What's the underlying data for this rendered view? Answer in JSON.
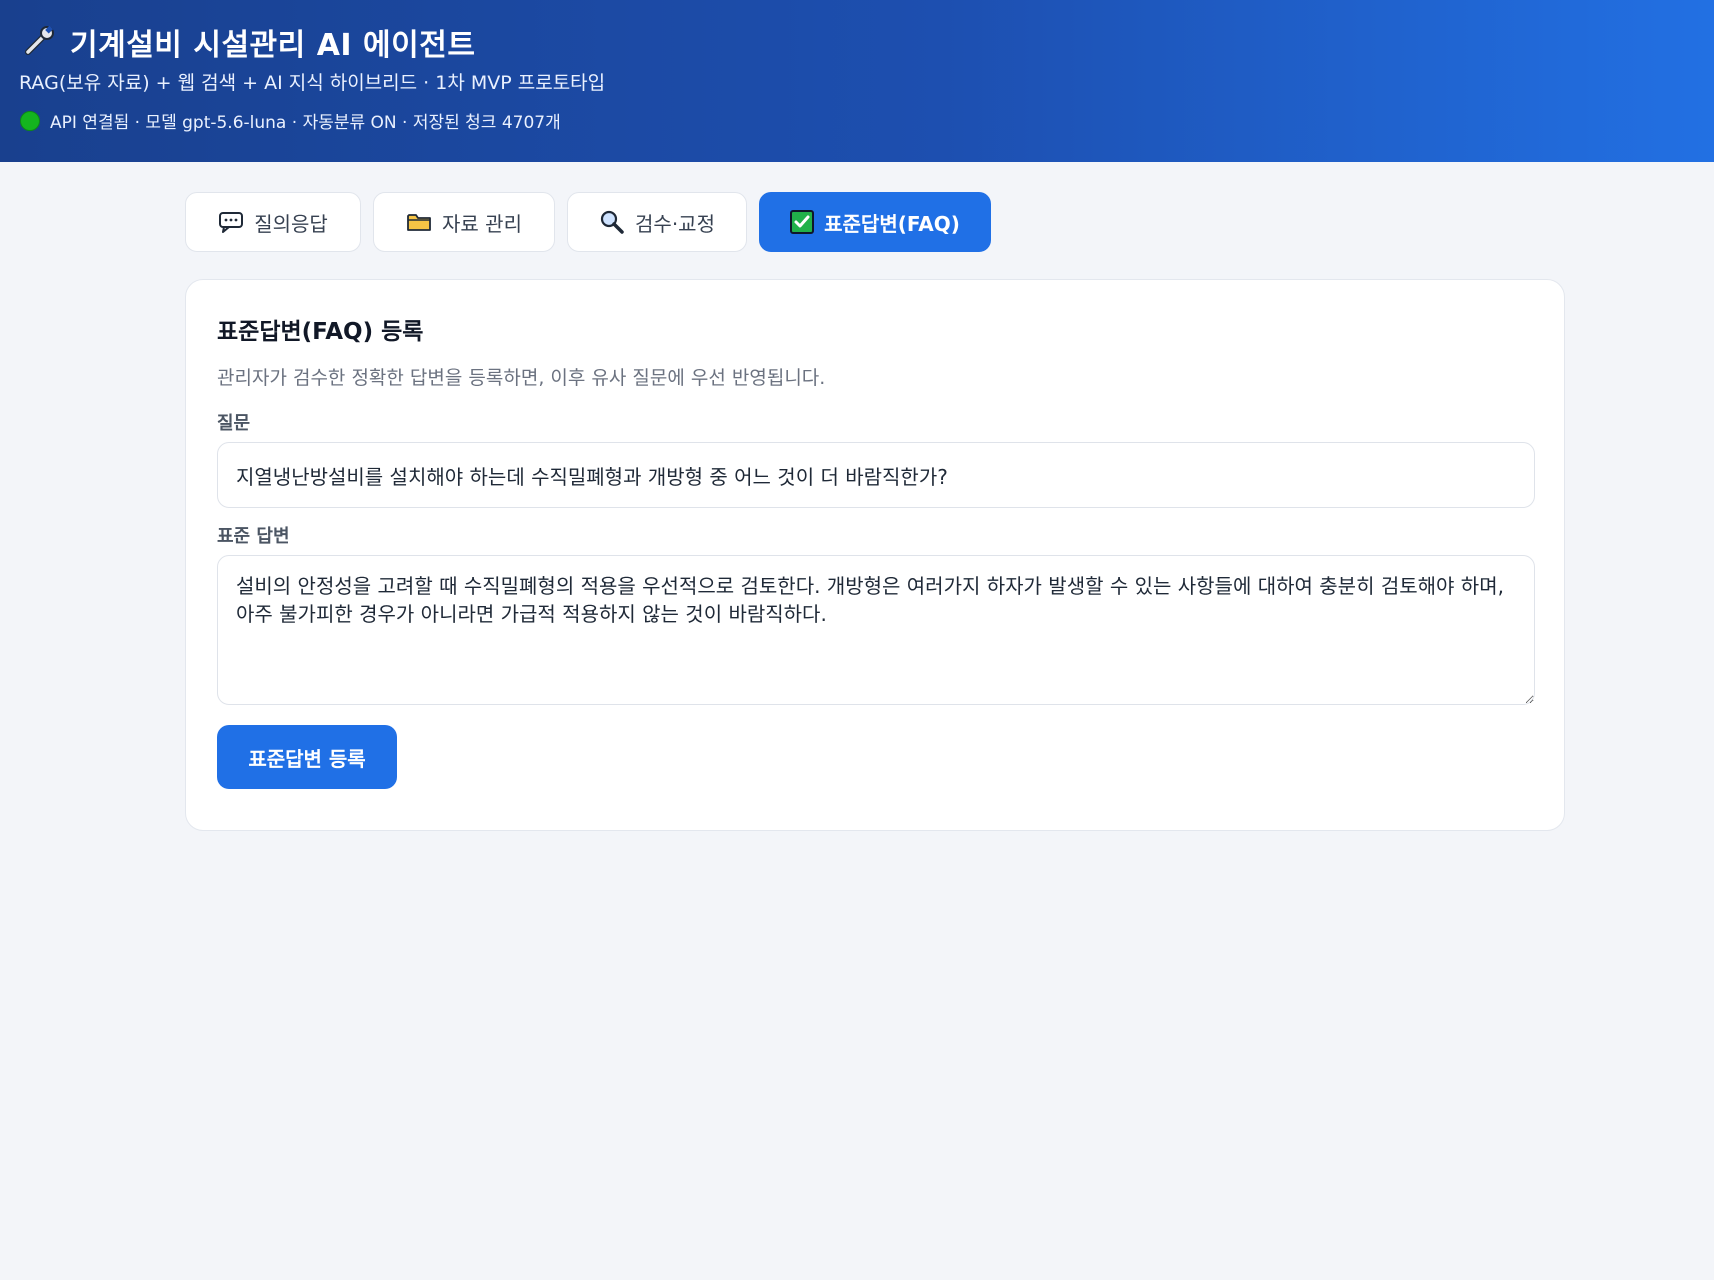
{
  "header": {
    "title": "기계설비 시설관리 AI 에이전트",
    "subtitle": "RAG(보유 자료) + 웹 검색 + AI 지식 하이브리드 · 1차 MVP 프로토타입",
    "status": "API 연결됨 · 모델 gpt-5.6-luna · 자동분류 ON · 저장된 청크 4707개",
    "icon": "wrench-icon",
    "status_color": "#14b51f"
  },
  "tabs": [
    {
      "label": "질의응답",
      "icon": "speech-bubble-icon",
      "active": false
    },
    {
      "label": "자료 관리",
      "icon": "folder-icon",
      "active": false
    },
    {
      "label": "검수·교정",
      "icon": "magnifier-icon",
      "active": false
    },
    {
      "label": "표준답변(FAQ)",
      "icon": "check-box-icon",
      "active": true
    }
  ],
  "faq_form": {
    "title": "표준답변(FAQ) 등록",
    "description": "관리자가 검수한 정확한 답변을 등록하면, 이후 유사 질문에 우선 반영됩니다.",
    "question_label": "질문",
    "question_value": "지열냉난방설비를 설치해야 하는데 수직밀폐형과 개방형 중 어느 것이 더 바람직한가?",
    "answer_label": "표준 답변",
    "answer_value": "설비의 안정성을 고려할 때 수직밀폐형의 적용을 우선적으로 검토한다. 개방형은 여러가지 하자가 발생할 수 있는 사항들에 대하여 충분히 검토해야 하며, 아주 불가피한 경우가 아니라면 가급적 적용하지 않는 것이 바람직하다.",
    "submit_label": "표준답변 등록"
  },
  "colors": {
    "accent": "#2070e6",
    "header_start": "#19408e",
    "header_end": "#2270e3",
    "background": "#f3f5f9"
  }
}
